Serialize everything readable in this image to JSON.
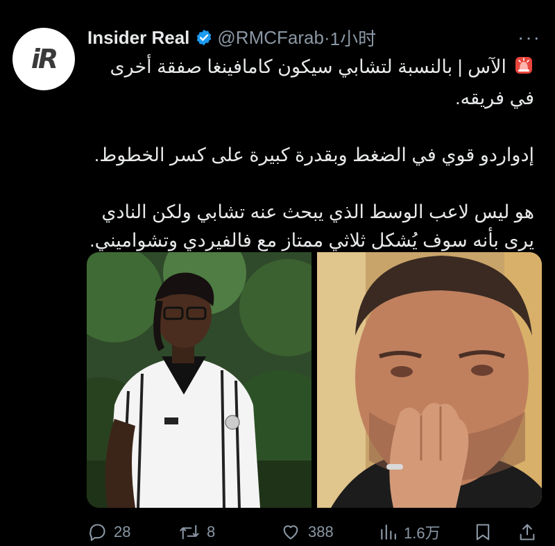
{
  "tweet": {
    "author_name": "Insider Real",
    "handle": "@RMCFarab",
    "separator": "·",
    "time": "1小时",
    "avatar_text": "iR",
    "paragraphs": [
      "الآس | بالنسبة لتشابي سيكون كامافينغا صفقة أخرى في فريقه.",
      "إدواردو قوي في الضغط وبقدرة كبيرة على كسر الخطوط.",
      "هو ليس لاعب الوسط الذي يبحث عنه تشابي ولكن النادي يرى بأنه سوف يُشكل ثلاثي ممتاز مع فالفيردي وتشواميني."
    ]
  },
  "actions": {
    "replies": "28",
    "retweets": "8",
    "likes": "388",
    "views": "1.6万"
  },
  "icons": {
    "verified": "verified-badge-icon",
    "siren": "police-siren-icon",
    "more": "more-dots-icon",
    "reply": "reply-icon",
    "retweet": "retweet-icon",
    "like": "heart-icon",
    "views": "views-chart-icon",
    "bookmark": "bookmark-icon",
    "share": "share-icon"
  },
  "colors": {
    "background": "#000000",
    "text": "#e7e9ea",
    "muted": "#8b98a5",
    "verified": "#1d9bf0"
  }
}
